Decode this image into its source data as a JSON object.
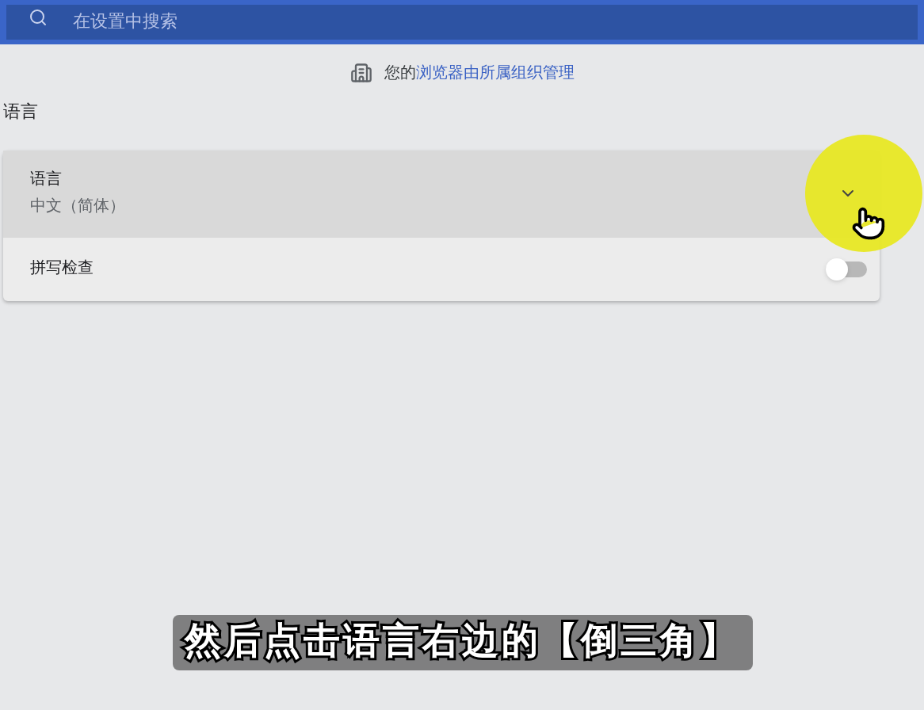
{
  "search": {
    "placeholder": "在设置中搜索"
  },
  "notice": {
    "prefix": "您的",
    "link": "浏览器由所属组织管理"
  },
  "section_title": "语言",
  "rows": [
    {
      "kind": "dropdown",
      "label": "语言",
      "value": "中文（简体）",
      "hovered": true
    },
    {
      "kind": "toggle",
      "label": "拼写检查",
      "on": false,
      "hovered": false
    }
  ],
  "caption": "然后点击语言右边的【倒三角】"
}
